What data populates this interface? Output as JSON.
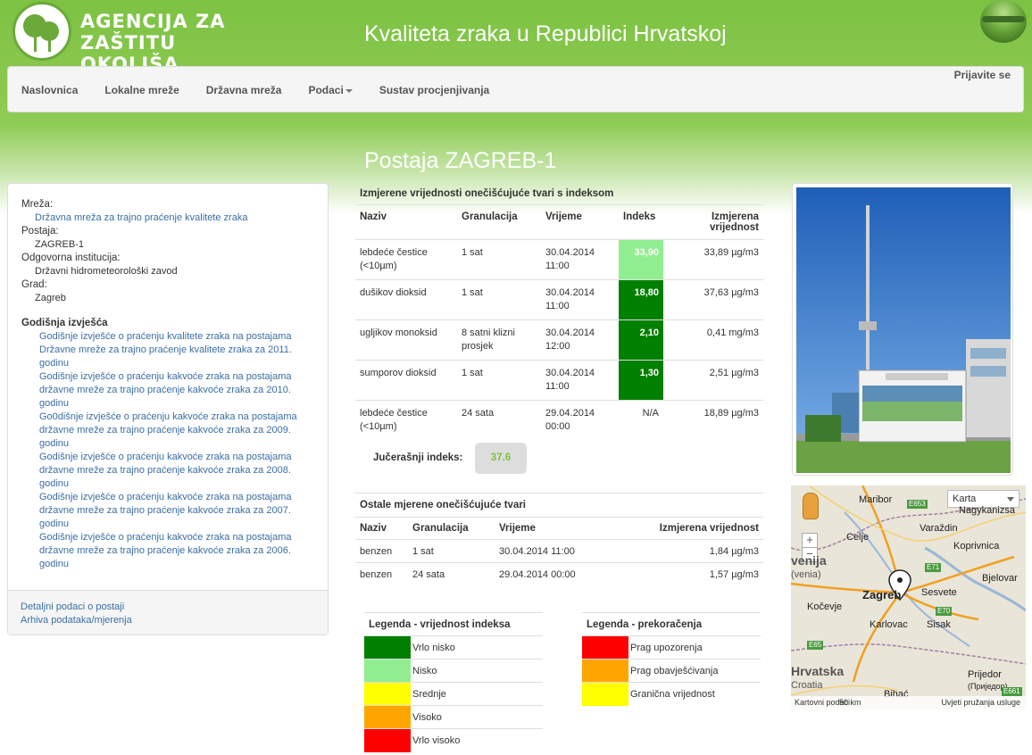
{
  "header": {
    "logo_text": "AGENCIJA ZA\nZAŠTITU OKOLIŠA",
    "site_title": "Kvaliteta zraka u Republici Hrvatskoj"
  },
  "nav": {
    "items": [
      "Naslovnica",
      "Lokalne mreže",
      "Državna mreža",
      "Podaci",
      "Sustav procjenjivanja"
    ],
    "login": "Prijavite se"
  },
  "station_title": "Postaja ZAGREB-1",
  "info": {
    "network_label": "Mreža:",
    "network_value": "Državna mreža za trajno praćenje kvalitete zraka",
    "station_label": "Postaja:",
    "station_value": "ZAGREB-1",
    "institution_label": "Odgovorna institucija:",
    "institution_value": "Državni hidrometeorološki zavod",
    "city_label": "Grad:",
    "city_value": "Zagreb",
    "reports_title": "Godišnja izvješća",
    "reports": [
      "Godišnje izvješće o praćenju kvalitete zraka na postajama Državne mreže za trajno praćenje kvalitete zraka za 2011. godinu",
      "Godišnje izvješće o praćenju kakvoće zraka na postajama državne mreže za trajno praćenje kakvoće zraka za 2010. godinu",
      "Go0dišnje izvješće o praćenju kakvoće zraka na postajama državne mreže za trajno praćenje kakvoće zraka za 2009. godinu",
      "Godišnje izvješće o praćenju kakvoće zraka na postajama državne mreže za trajno praćenje kakvoće zraka za 2008. godinu",
      "Godišnje izvješće o praćenju kakvoće zraka na postajama državne mreže za trajno praćenje kakvoće zraka za 2007. godinu",
      "Godišnje izvješće o praćenju kakvoće zraka na postajama državne mreže za trajno praćenje kakvoće zraka za 2006. godinu"
    ],
    "footer_links": [
      "Detaljni podaci o postaji",
      "Arhiva podataka/mjerenja"
    ]
  },
  "measured": {
    "caption": "Izmjerene vrijednosti onečišćujuće tvari s indeksom",
    "headers": [
      "Naziv",
      "Granulacija",
      "Vrijeme",
      "Indeks",
      "Izmjerena vrijednost"
    ],
    "rows": [
      {
        "name": "lebdeće čestice (<10µm)",
        "gran": "1 sat",
        "time": "30.04.2014 11:00",
        "index": "33,90",
        "index_color": "#90ee90",
        "value": "33,89 µg/m3"
      },
      {
        "name": "dušikov dioksid",
        "gran": "1 sat",
        "time": "30.04.2014 11:00",
        "index": "18,80",
        "index_color": "#008000",
        "value": "37,63 µg/m3"
      },
      {
        "name": "ugljikov monoksid",
        "gran": "8 satni klizni prosjek",
        "time": "30.04.2014 12:00",
        "index": "2,10",
        "index_color": "#008000",
        "value": "0,41 mg/m3"
      },
      {
        "name": "sumporov dioksid",
        "gran": "1 sat",
        "time": "30.04.2014 11:00",
        "index": "1,30",
        "index_color": "#008000",
        "value": "2,51 µg/m3"
      },
      {
        "name": "lebdeće čestice (<10µm)",
        "gran": "24 sata",
        "time": "29.04.2014 00:00",
        "index": "N/A",
        "index_color": "",
        "value": "18,89 µg/m3"
      }
    ]
  },
  "yesterday": {
    "label": "Jučerašnji indeks:",
    "value": "37.6"
  },
  "other": {
    "caption": "Ostale mjerene onečišćujuće tvari",
    "headers": [
      "Naziv",
      "Granulacija",
      "Vrijeme",
      "Izmjerena vrijednost"
    ],
    "rows": [
      {
        "name": "benzen",
        "gran": "1 sat",
        "time": "30.04.2014 11:00",
        "value": "1,84 µg/m3"
      },
      {
        "name": "benzen",
        "gran": "24 sata",
        "time": "29.04.2014 00:00",
        "value": "1,57 µg/m3"
      }
    ]
  },
  "legend_index": {
    "title": "Legenda - vrijednost indeksa",
    "items": [
      {
        "label": "Vrlo nisko",
        "color": "#008000"
      },
      {
        "label": "Nisko",
        "color": "#90ee90"
      },
      {
        "label": "Srednje",
        "color": "#ffff00"
      },
      {
        "label": "Visoko",
        "color": "#ffa500"
      },
      {
        "label": "Vrlo visoko",
        "color": "#ff0000"
      }
    ]
  },
  "legend_exceed": {
    "title": "Legenda - prekoračenja",
    "items": [
      {
        "label": "Prag upozorenja",
        "color": "#ff0000"
      },
      {
        "label": "Prag obavješćivanja",
        "color": "#ffa500"
      },
      {
        "label": "Granična vrijednost",
        "color": "#ffff00"
      }
    ]
  },
  "map": {
    "type_label": "Karta",
    "zoom_in": "+",
    "zoom_out": "−",
    "cities": [
      "Maribor",
      "Nagykanizsa",
      "Celje",
      "Varaždin",
      "Koprivnica",
      "Zagreb",
      "Sesvete",
      "Bjelovar",
      "Kočevje",
      "Karlovac",
      "Sisak",
      "Prijedor",
      "(Приједор)",
      "Bihać"
    ],
    "countries": [
      "venija",
      "(venia)",
      "Hrvatska",
      "Croatia"
    ],
    "roads": [
      "E653",
      "E71",
      "E70",
      "E65",
      "E661"
    ],
    "footer_data": "Kartovni podaci",
    "footer_scale": "50 km",
    "footer_terms": "Uvjeti pružanja usluge"
  }
}
